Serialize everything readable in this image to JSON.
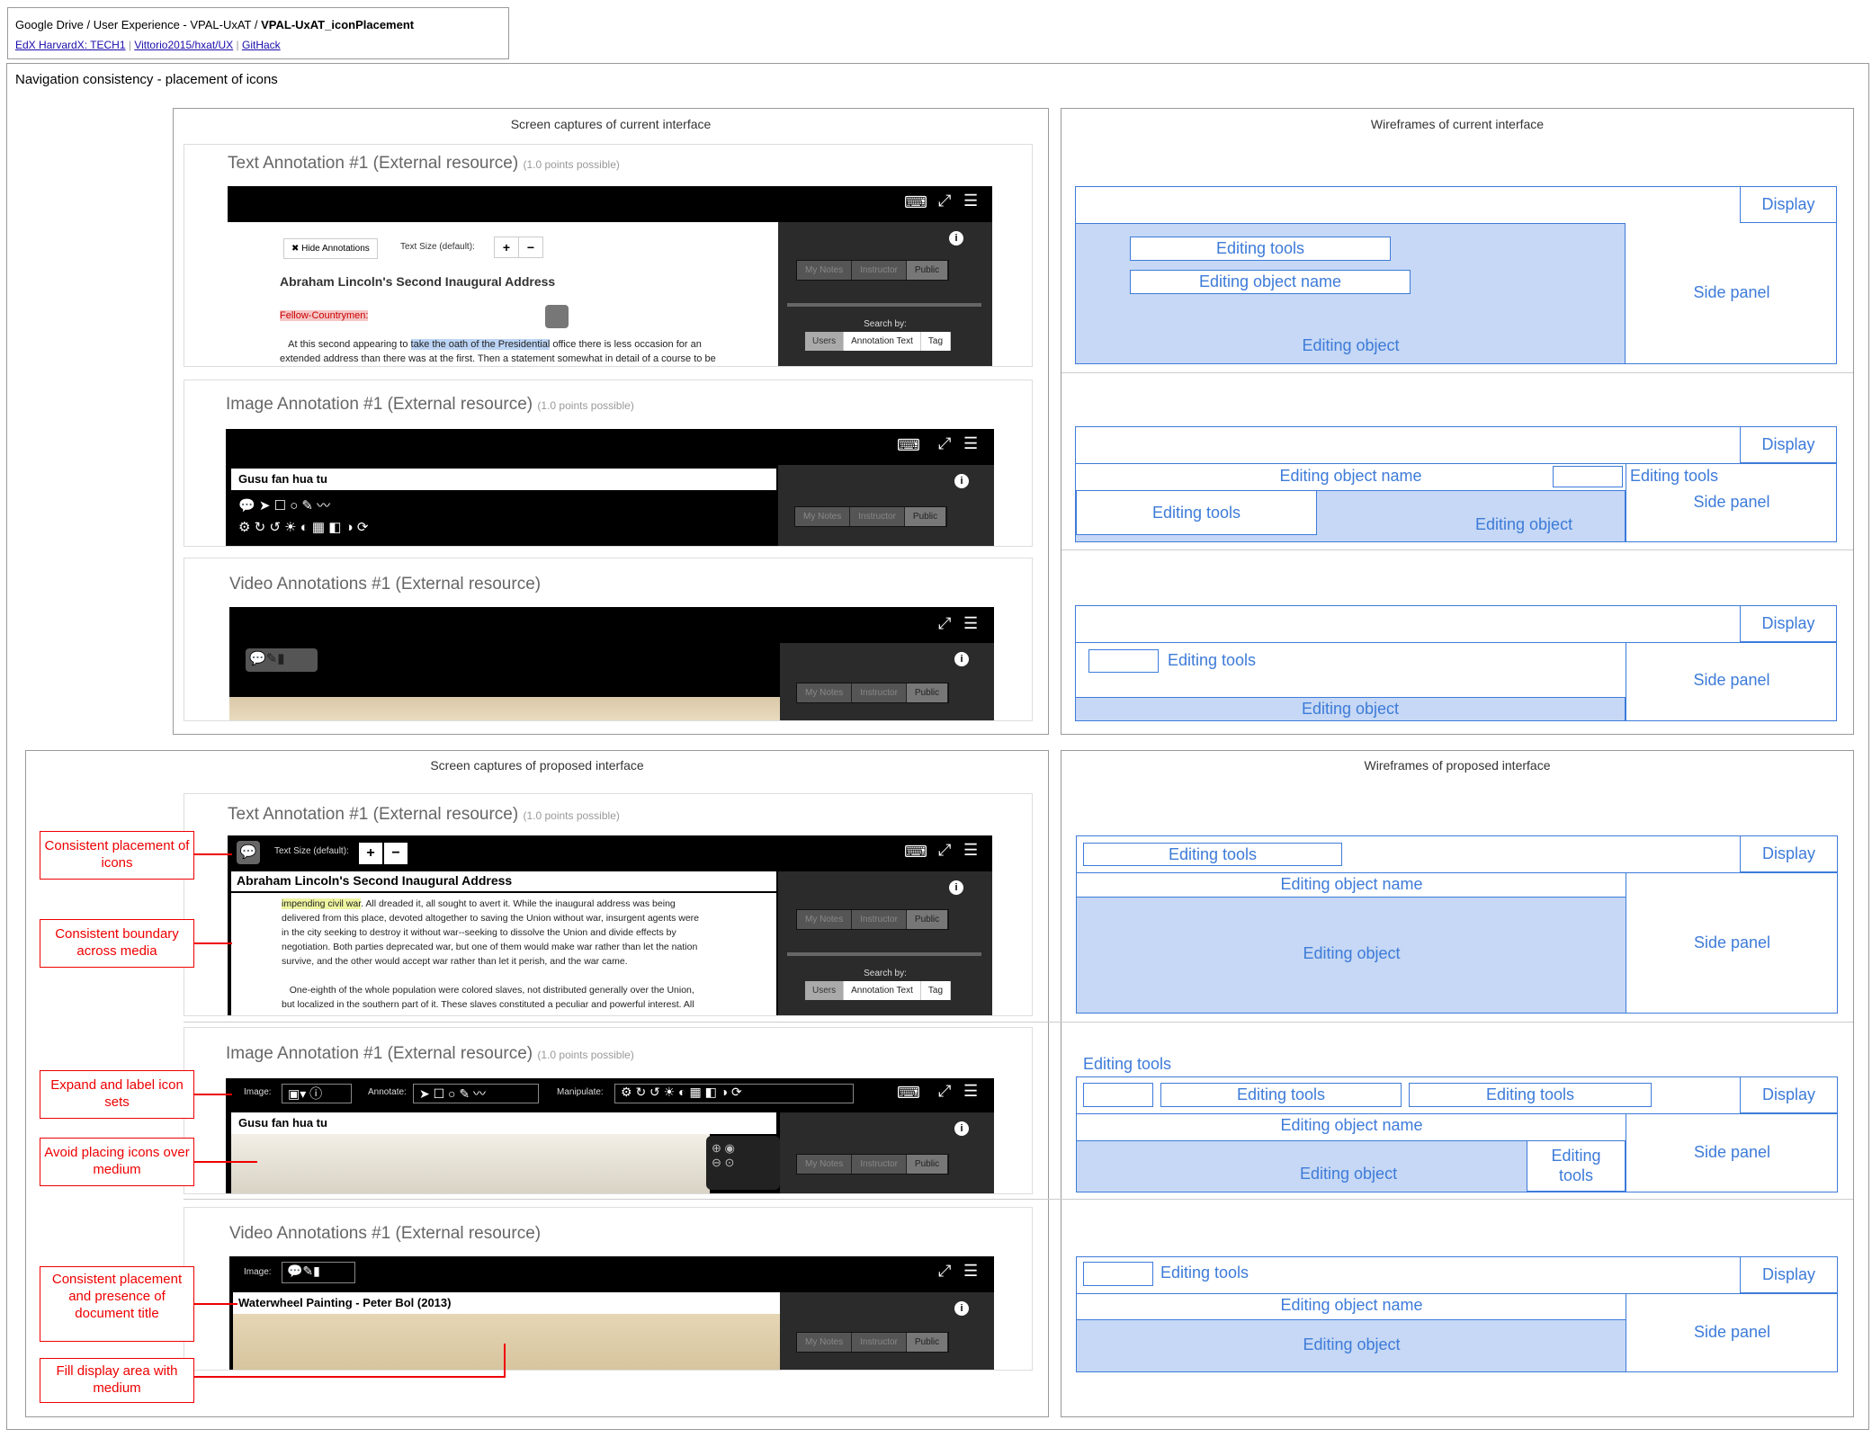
{
  "header": {
    "breadcrumb": "Google Drive / User Experience - VPAL-UxAT / ",
    "breadcrumb_bold": "VPAL-UxAT_iconPlacement",
    "links": [
      "EdX HarvardX: TECH1",
      "Vittorio2015/hxat/UX",
      "GitHack"
    ],
    "sep": "|"
  },
  "page_title": "Navigation consistency - placement of icons",
  "sections": {
    "current_caps": "Screen captures of current interface",
    "current_wire": "Wireframes of current interface",
    "proposed_caps": "Screen captures of proposed interface",
    "proposed_wire": "Wireframes of proposed interface"
  },
  "titles": {
    "text": "Text Annotation #1 (External resource)",
    "image": "Image Annotation #1 (External resource)",
    "video": "Video Annotations #1 (External resource)",
    "points": "(1.0 points possible)"
  },
  "ui": {
    "hide": "✖ Hide Annotations",
    "text_size": "Text Size (default):",
    "doc_title": "Abraham Lincoln's Second Inaugural Address",
    "fellow": "Fellow-Countrymen:",
    "para1a": "At this second appearing to ",
    "para1hl": "take the oath of the Presidential",
    "para1b": " office there is less occasion for an",
    "para2": "extended address than there was at the first. Then a statement somewhat in detail of a course to be",
    "prop_hl": "impending civil war",
    "prop_lines": [
      ". All dreaded it, all sought to avert it. While the inaugural address was being",
      "delivered from this place, devoted altogether to saving the Union without war, insurgent agents were",
      "in the city seeking to destroy it without war--seeking to dissolve the Union and divide effects by",
      "negotiation. Both parties deprecated war, but one of them would make war rather than let the nation",
      "survive, and the other would accept war rather than let it perish, and the war came.",
      "One-eighth of the whole population were colored slaves, not distributed generally over the Union,",
      "but localized in the southern part of it. These slaves constituted a peculiar and powerful interest. All"
    ],
    "seg": [
      "My Notes",
      "Instructor",
      "Public"
    ],
    "search_by": "Search by:",
    "search_opts": [
      "Users",
      "Annotation Text",
      "Tag"
    ],
    "gusu": "Gusu fan hua tu",
    "image_lbl": "Image:",
    "annotate_lbl": "Annotate:",
    "manipulate_lbl": "Manipulate:",
    "waterwheel": "Waterwheel Painting - Peter Bol (2013)",
    "plus": "+",
    "minus": "−"
  },
  "wire": {
    "display": "Display",
    "tools": "Editing tools",
    "name": "Editing object name",
    "object": "Editing object",
    "side": "Side panel",
    "tools_2line_a": "Editing",
    "tools_2line_b": "tools"
  },
  "callouts": [
    "Consistent placement of icons",
    "Consistent boundary across media",
    "Expand and label icon sets",
    "Avoid placing icons over medium",
    "Consistent placement and presence of document title",
    "Fill display area with medium"
  ],
  "colors": {
    "wire_blue": "#3d7bd9",
    "wire_fill": "#c6d8f5",
    "callout_red": "#e00"
  }
}
